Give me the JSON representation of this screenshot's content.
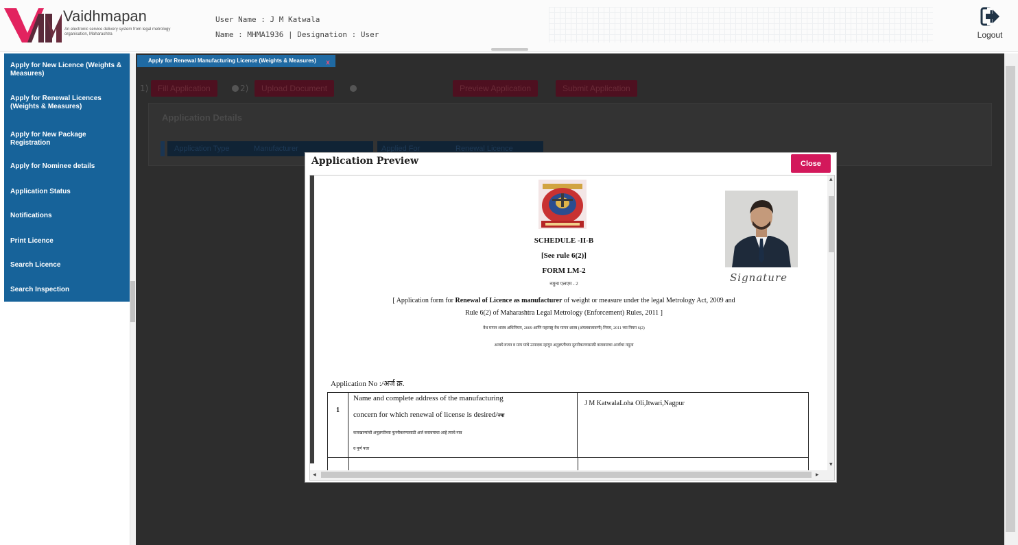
{
  "header": {
    "brand": "Vaidhmapan",
    "tagline": "An electronic service delivery system from legal metrology organisation, Maharashtra",
    "user_name": "User Name : J M Katwala",
    "name_line": "Name : MHMA1936 | Designation : User",
    "logout_label": "Logout",
    "logout_icon": "logout-icon"
  },
  "sidebar": {
    "items": [
      {
        "label": "Apply for New Licence (Weights & Measures)"
      },
      {
        "label": "Apply for Renewal Licences (Weights & Measures)"
      },
      {
        "label": "Apply for New Package Registration"
      },
      {
        "label": "Apply for Nominee details"
      },
      {
        "label": "Application Status"
      },
      {
        "label": "Notifications"
      },
      {
        "label": "Print Licence"
      },
      {
        "label": "Search Licence"
      },
      {
        "label": "Search Inspection"
      }
    ]
  },
  "main": {
    "tab_label": "Apply for Renewal Manufacturing Licence (Weights & Measures)",
    "tab_close": "x",
    "steps": {
      "n1": "1)",
      "fill_app": "Fill Application",
      "n2": "2)",
      "upload": "Upload Document",
      "preview": "Preview Application",
      "submit": "Submit Application"
    },
    "section_title": "Application Details",
    "pills": {
      "app_type_label": "Application Type",
      "app_type_value": "Manufacturer",
      "applied_for_label": "Applied For",
      "applied_for_value": "Renewal Licence"
    }
  },
  "modal": {
    "title": "Application Preview",
    "close_label": "Close",
    "doc": {
      "schedule": "SCHEDULE -II-B",
      "rule": "[See rule 6(2)]",
      "form": "FORM LM-2",
      "form_marathi": "नमुना एलएम - 2",
      "app_line1_pre": "[ Application form for ",
      "app_line1_bold": "Renewal of Licence as manufacturer",
      "app_line1_post": " of weight or measure under the legal Metrology Act, 2009 and",
      "app_line2": "Rule 6(2) of Maharashtra Legal Metrology (Enforcement) Rules, 2011 ]",
      "marathi_line1": "वैध मापन शास्त्र अधिनियम, 2009 आणि महाराष्ट्र वैध मापन शास्त्र (अंमलबजावणी) नियम, 2011 च्या नियम 6(2)",
      "marathi_line2": "अन्वये वजन व माप यांचे उत्पादक म्हणून अनुज्ञप्तीच्या नूतनीकरणासाठी करावयाचा अर्जाचा नमुना",
      "application_no": "Application No :/अर्ज क्र.",
      "signature": "Signature",
      "table": {
        "row_num": "1",
        "q_line1": "Name and complete address of the manufacturing",
        "q_line2": "concern for which renewal of license is desired/",
        "q_line2_bold": "ज्या",
        "q_line3": "कारखान्यांची अनुज्ञप्तीच्या नूतनीकरणासाठी अर्ज करावयाचा आहे त्याचे नाव",
        "q_line4": "व पूर्ण पत्ता",
        "answer": "J M KatwalaLoha Oli,Itwari,Nagpur"
      }
    }
  },
  "colors": {
    "sidebar": "#17639a",
    "close_button": "#d3185b",
    "overlay": "#2d2d2d",
    "step_button": "#4e1020"
  }
}
